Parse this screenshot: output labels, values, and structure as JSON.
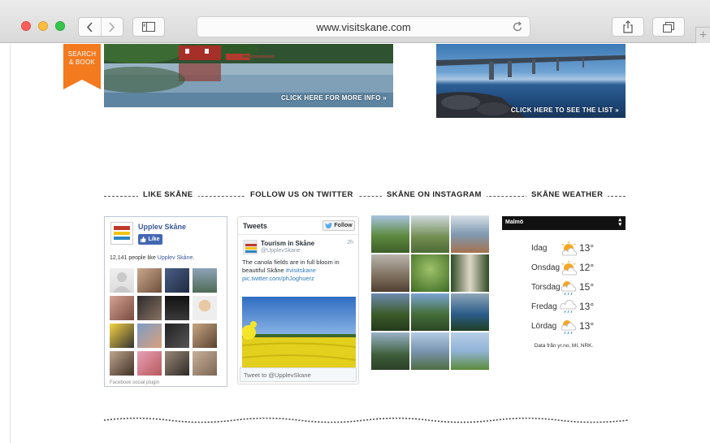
{
  "browser": {
    "url": "www.visitskane.com"
  },
  "page": {
    "search_book": {
      "line1": "SEARCH",
      "line2": "& BOOK"
    },
    "hero_left": {
      "cta": "CLICK HERE FOR MORE INFO »"
    },
    "hero_right": {
      "cta": "CLICK HERE TO SEE THE LIST »"
    },
    "sections": [
      "LIKE SKÅNE",
      "FOLLOW US ON TWITTER",
      "SKÅNE ON INSTAGRAM",
      "SKÅNE WEATHER"
    ],
    "facebook": {
      "page_name": "Upplev Skåne",
      "like_label": "Like",
      "count_text": "12,141 people like ",
      "count_link": "Upplev Skåne",
      "count_suffix": ".",
      "plugin_label": "Facebook social plugin",
      "logo_text": "UPPLEV SKÅNE"
    },
    "twitter": {
      "title": "Tweets",
      "follow_label": "Follow",
      "author": "Tourism in Skåne",
      "handle": "@UpplevSkane",
      "time": "2h",
      "text_main": "The canola fields are in full bloom in beautiful Skåne ",
      "hashtag": "#visitskane",
      "link": "pic.twitter.com/phJoghuerz",
      "input_placeholder": "Tweet to @UpplevSkane"
    },
    "weather": {
      "city": "Malmö",
      "days": [
        {
          "day": "Idag",
          "temp": "13°",
          "icon": "sun-cloud-icon"
        },
        {
          "day": "Onsdag",
          "temp": "12°",
          "icon": "sun-cloud-icon"
        },
        {
          "day": "Torsdag",
          "temp": "15°",
          "icon": "sun-cloud-rain-icon"
        },
        {
          "day": "Fredag",
          "temp": "13°",
          "icon": "cloud-rain-icon"
        },
        {
          "day": "Lördag",
          "temp": "13°",
          "icon": "sun-cloud-rain-icon"
        }
      ],
      "source": "Data från yr.no, MI, NRK."
    }
  },
  "colors": {
    "brand_orange": "#f47a20",
    "facebook_blue": "#3b5998",
    "twitter_blue": "#2b7bb9"
  }
}
